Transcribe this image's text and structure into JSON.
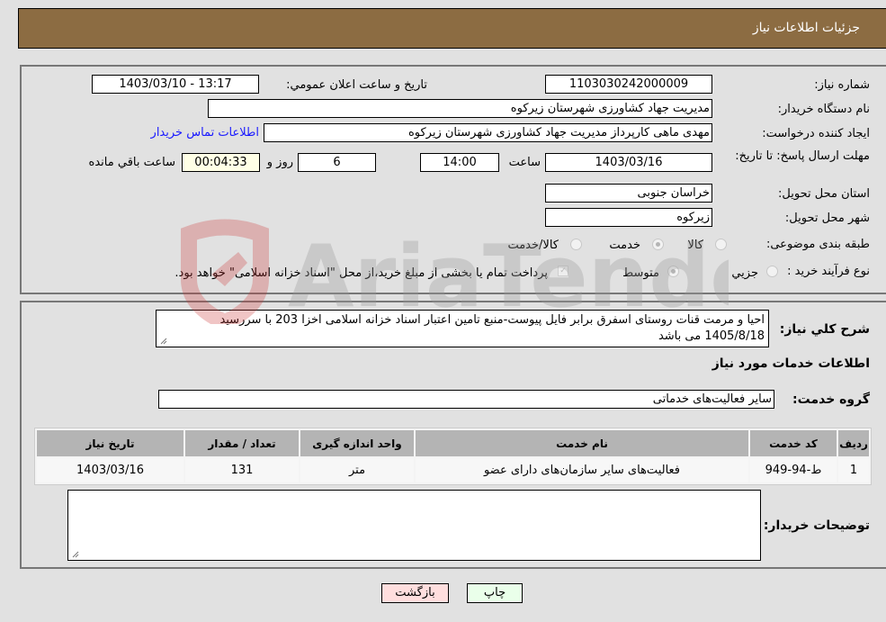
{
  "header": {
    "title": "جزئیات اطلاعات نیاز"
  },
  "fields": {
    "need_number": {
      "label": "شماره نیاز:",
      "value": "1103030242000009"
    },
    "announce_datetime": {
      "label": "تاريخ و ساعت اعلان عمومي:",
      "value": "1403/03/10 - 13:17"
    },
    "buyer_org": {
      "label": "نام دستگاه خریدار:",
      "value": "مدیریت جهاد کشاورزی شهرستان زیرکوه"
    },
    "requester": {
      "label": "ایجاد کننده درخواست:",
      "value": "مهدی ماهی کارپرداز مدیریت جهاد کشاورزی شهرستان زیرکوه"
    },
    "buyer_contact_link": "اطلاعات تماس خریدار",
    "deadline": {
      "label": "مهلت ارسال پاسخ: تا تاریخ:",
      "date": "1403/03/16",
      "time_label": "ساعت",
      "time": "14:00",
      "days": "6",
      "days_label": "روز و",
      "remaining": "00:04:33",
      "remaining_label": "ساعت باقي مانده"
    },
    "province": {
      "label": "استان محل تحویل:",
      "value": "خراسان جنوبی"
    },
    "city": {
      "label": "شهر محل تحویل:",
      "value": "زیرکوه"
    },
    "category": {
      "label": "طبقه بندی موضوعی:",
      "options": [
        "کالا",
        "خدمت",
        "کالا/خدمت"
      ],
      "selected": "خدمت"
    },
    "purchase_type": {
      "label": "نوع فرآیند خرید :",
      "options": [
        "جزيي",
        "متوسط"
      ],
      "selected": "متوسط",
      "treasury_note": "پرداخت تمام یا بخشی از مبلغ خرید،از محل \"اسناد خزانه اسلامی\" خواهد بود.",
      "treasury_checked": true
    }
  },
  "description": {
    "label": "شرح كلي نياز:",
    "value": "احیا و مرمت قنات روستای اسفرق برابر فایل پیوست-منبع تامین اعتبار اسناد خزانه اسلامی اخزا 203 با سررسید 1405/8/18 می باشد"
  },
  "services_section": {
    "title": "اطلاعات خدمات مورد نياز",
    "group_label": "گروه خدمت:",
    "group_value": "سایر فعالیت‌های خدماتی"
  },
  "table": {
    "headers": [
      "ردیف",
      "کد خدمت",
      "نام خدمت",
      "واحد اندازه گیری",
      "تعداد / مقدار",
      "تاریخ نیاز"
    ],
    "rows": [
      [
        "1",
        "ط-94-949",
        "فعالیت‌های سایر سازمان‌های دارای عضو",
        "متر",
        "131",
        "1403/03/16"
      ]
    ]
  },
  "buyer_notes": {
    "label": "توضیحات خریدار:",
    "value": ""
  },
  "buttons": {
    "print": "چاپ",
    "back": "بازگشت"
  },
  "watermark": {
    "text": "AriaTender.neT"
  },
  "colors": {
    "header_bg": "#8c6c42",
    "print_bg": "#eaffea",
    "back_bg": "#ffdede",
    "link": "#1a1aff"
  }
}
